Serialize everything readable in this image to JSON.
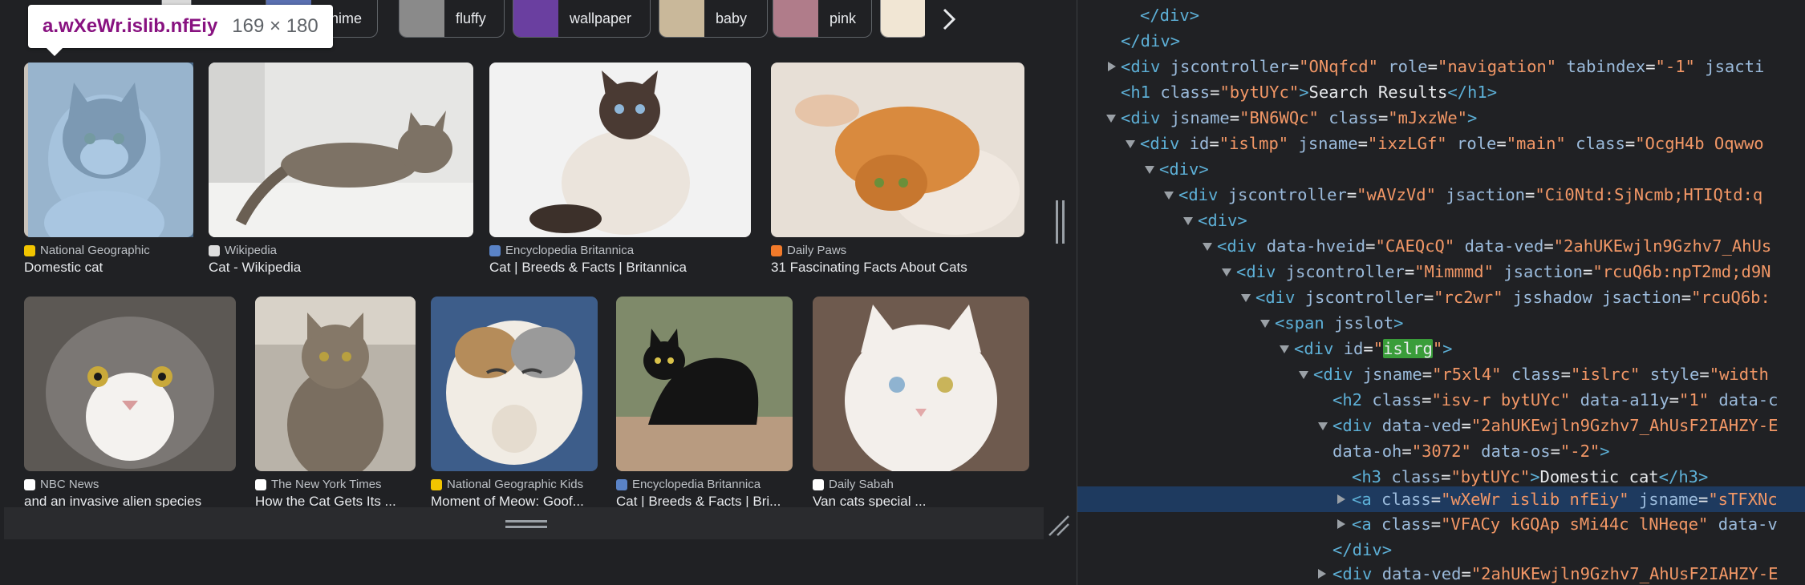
{
  "tooltip": {
    "selector": "a.wXeWr.islib.nfEiy",
    "size": "169 × 180"
  },
  "chips": [
    {
      "label": "anime",
      "thumb_color": "#5a6fb0"
    },
    {
      "label": "fluffy",
      "thumb_color": "#8a8a8a"
    },
    {
      "label": "wallpaper",
      "thumb_color": "#6a3fa0"
    },
    {
      "label": "baby",
      "thumb_color": "#c9b89a"
    },
    {
      "label": "pink",
      "thumb_color": "#b07c8a"
    },
    {
      "label": "",
      "thumb_color": "#f1e6d4"
    }
  ],
  "results_row1": [
    {
      "source": "National Geographic",
      "title": "Domestic cat",
      "fav": "#f2c500"
    },
    {
      "source": "Wikipedia",
      "title": "Cat - Wikipedia",
      "fav": "#dddddd"
    },
    {
      "source": "Encyclopedia Britannica",
      "title": "Cat | Breeds & Facts | Britannica",
      "fav": "#5a83c7"
    },
    {
      "source": "Daily Paws",
      "title": "31 Fascinating Facts About Cats",
      "fav": "#f27a2a"
    }
  ],
  "results_row2": [
    {
      "source": "NBC News",
      "title": "and an invasive alien species",
      "fav": "#ffffff"
    },
    {
      "source": "The New York Times",
      "title": "How the Cat Gets Its ...",
      "fav": "#ffffff"
    },
    {
      "source": "National Geographic Kids",
      "title": "Moment of Meow: Goof...",
      "fav": "#f2c500"
    },
    {
      "source": "Encyclopedia Britannica",
      "title": "Cat | Breeds & Facts | Bri...",
      "fav": "#5a83c7"
    },
    {
      "source": "Daily Sabah",
      "title": "Van cats special ...",
      "fav": "#ffffff"
    }
  ],
  "colors": {
    "highlight": "#6fa8dc",
    "selected_row": "#1e3a5f",
    "search_hit": "#3a9d3a"
  },
  "dom": {
    "l0": {
      "tag": "</div>"
    },
    "l1": {
      "tag": "</div>"
    },
    "l2": {
      "open": "<div",
      "a1": "jscontroller",
      "v1": "\"ONqfcd\"",
      "a2": "role",
      "v2": "\"navigation\"",
      "a3": "tabindex",
      "v3": "\"-1\"",
      "a4": "jsacti"
    },
    "l3": {
      "open": "<h1",
      "a1": "class",
      "v1": "\"bytUYc\"",
      "close": ">",
      "text": "Search Results",
      "end": "</h1>"
    },
    "l4": {
      "open": "<div",
      "a1": "jsname",
      "v1": "\"BN6WQc\"",
      "a2": "class",
      "v2": "\"mJxzWe\"",
      "close": ">"
    },
    "l5": {
      "open": "<div",
      "a1": "id",
      "v1": "\"islmp\"",
      "a2": "jsname",
      "v2": "\"ixzLGf\"",
      "a3": "role",
      "v3": "\"main\"",
      "a4": "class",
      "v4": "\"OcgH4b Oqwwo"
    },
    "l6": {
      "tag": "<div>"
    },
    "l7": {
      "open": "<div",
      "a1": "jscontroller",
      "v1": "\"wAVzVd\"",
      "a2": "jsaction",
      "v2": "\"Ci0Ntd:SjNcmb;HTIQtd:q"
    },
    "l8": {
      "tag": "<div>"
    },
    "l9": {
      "open": "<div",
      "a1": "data-hveid",
      "v1": "\"CAEQcQ\"",
      "a2": "data-ved",
      "v2": "\"2ahUKEwjln9Gzhv7_AhUs"
    },
    "l10": {
      "open": "<div",
      "a1": "jscontroller",
      "v1": "\"Mimmmd\"",
      "a2": "jsaction",
      "v2": "\"rcuQ6b:npT2md;d9N"
    },
    "l11": {
      "open": "<div",
      "a1": "jscontroller",
      "v1": "\"rc2wr\"",
      "a2": "jsshadow",
      "a3": "jsaction",
      "v3": "\"rcuQ6b:"
    },
    "l12": {
      "open": "<span",
      "a1": "jsslot",
      "close": ">"
    },
    "l13": {
      "open": "<div",
      "a1": "id",
      "q": "\"",
      "hit": "islrg",
      "q2": "\"",
      "close": ">"
    },
    "l14": {
      "open": "<div",
      "a1": "jsname",
      "v1": "\"r5xl4\"",
      "a2": "class",
      "v2": "\"islrc\"",
      "a3": "style",
      "v3": "\"width"
    },
    "l15": {
      "open": "<h2",
      "a1": "class",
      "v1": "\"isv-r bytUYc\"",
      "a2": "data-a11y",
      "v2": "\"1\"",
      "a3": "data-c"
    },
    "l16": {
      "open": "<div",
      "a1": "data-ved",
      "v1": "\"2ahUKEwjln9Gzhv7_AhUsF2IAHZY-E"
    },
    "l17": {
      "a1": "data-oh",
      "v1": "\"3072\"",
      "a2": "data-os",
      "v2": "\"-2\"",
      "close": ">"
    },
    "l18": {
      "open": "<h3",
      "a1": "class",
      "v1": "\"bytUYc\"",
      "close": ">",
      "text": "Domestic cat",
      "end": "</h3>"
    },
    "l19": {
      "open": "<a",
      "a1": "class",
      "v1": "\"wXeWr islib nfEiy\"",
      "a2": "jsname",
      "v2": "\"sTFXNc"
    },
    "l20": {
      "open": "<a",
      "a1": "class",
      "v1": "\"VFACy kGQAp sMi44c lNHeqe\"",
      "a2": "data-v"
    },
    "l21": {
      "tag": "</div>"
    },
    "l22": {
      "open": "<div",
      "a1": "data-ved",
      "v1": "\"2ahUKEwjln9Gzhv7_AhUsF2IAHZY-E"
    }
  }
}
